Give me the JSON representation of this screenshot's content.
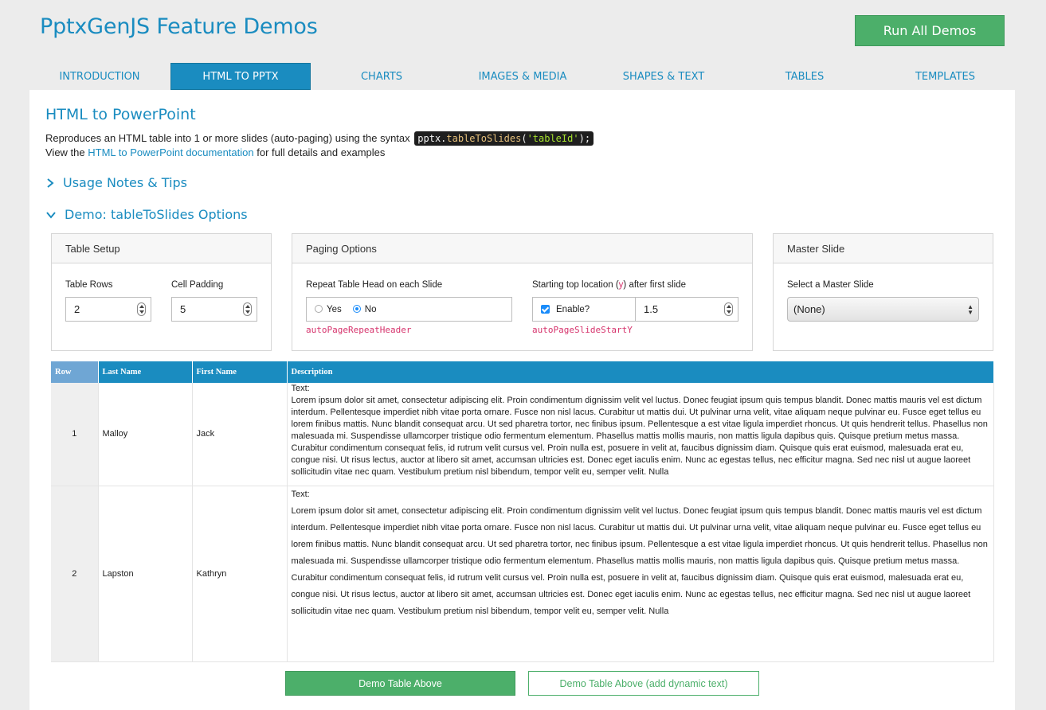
{
  "header": {
    "title": "PptxGenJS Feature Demos",
    "run_all_label": "Run All Demos"
  },
  "tabs": [
    {
      "label": "INTRODUCTION"
    },
    {
      "label": "HTML TO PPTX",
      "active": true
    },
    {
      "label": "CHARTS"
    },
    {
      "label": "IMAGES & MEDIA"
    },
    {
      "label": "SHAPES & TEXT"
    },
    {
      "label": "TABLES"
    },
    {
      "label": "TEMPLATES"
    }
  ],
  "section": {
    "title": "HTML to PowerPoint",
    "intro_text": "Reproduces an HTML table into 1 or more slides (auto-paging) using the syntax",
    "code": {
      "obj": "pptx.",
      "method": "tableToSlides",
      "open": "(",
      "arg": "'tableId'",
      "close": ");"
    },
    "docs_prefix": "View the",
    "docs_link": "HTML to PowerPoint documentation",
    "docs_suffix": "for full details and examples",
    "accordion_notes": "Usage Notes & Tips",
    "accordion_demo": "Demo: tableToSlides Options"
  },
  "table_setup": {
    "title": "Table Setup",
    "rows_label": "Table Rows",
    "rows_value": "2",
    "padding_label": "Cell Padding",
    "padding_value": "5"
  },
  "paging": {
    "title": "Paging Options",
    "repeat_label": "Repeat Table Head on each Slide",
    "yes_label": "Yes",
    "no_label": "No",
    "repeat_selected": "No",
    "repeat_prop": "autoPageRepeatHeader",
    "start_label_pre": "Starting top location (",
    "start_label_y": "y",
    "start_label_post": ") after first slide",
    "enable_label": "Enable?",
    "enable_checked": true,
    "start_value": "1.5",
    "start_prop": "autoPageSlideStartY"
  },
  "master": {
    "title": "Master Slide",
    "select_label": "Select a Master Slide",
    "selected": "(None)"
  },
  "demo_table": {
    "headers": [
      "Row",
      "Last Name",
      "First Name",
      "Description"
    ],
    "rows": [
      {
        "num": "1",
        "last": "Malloy",
        "first": "Jack",
        "desc_title": "Text:",
        "desc": "Lorem ipsum dolor sit amet, consectetur adipiscing elit. Proin condimentum dignissim velit vel luctus. Donec feugiat ipsum quis tempus blandit. Donec mattis mauris vel est dictum interdum. Pellentesque imperdiet nibh vitae porta ornare. Fusce non nisl lacus. Curabitur ut mattis dui. Ut pulvinar urna velit, vitae aliquam neque pulvinar eu. Fusce eget tellus eu lorem finibus mattis. Nunc blandit consequat arcu. Ut sed pharetra tortor, nec finibus ipsum. Pellentesque a est vitae ligula imperdiet rhoncus. Ut quis hendrerit tellus. Phasellus non malesuada mi. Suspendisse ullamcorper tristique odio fermentum elementum. Phasellus mattis mollis mauris, non mattis ligula dapibus quis. Quisque pretium metus massa. Curabitur condimentum consequat felis, id rutrum velit cursus vel. Proin nulla est, posuere in velit at, faucibus dignissim diam. Quisque quis erat euismod, malesuada erat eu, congue nisi. Ut risus lectus, auctor at libero sit amet, accumsan ultricies est. Donec eget iaculis enim. Nunc ac egestas tellus, nec efficitur magna. Sed nec nisl ut augue laoreet sollicitudin vitae nec quam. Vestibulum pretium nisl bibendum, tempor velit eu, semper velit. Nulla"
      },
      {
        "num": "2",
        "last": "Lapston",
        "first": "Kathryn",
        "desc_title": "Text:",
        "desc": "Lorem ipsum dolor sit amet, consectetur adipiscing elit. Proin condimentum dignissim velit vel luctus. Donec feugiat ipsum quis tempus blandit. Donec mattis mauris vel est dictum interdum. Pellentesque imperdiet nibh vitae porta ornare. Fusce non nisl lacus. Curabitur ut mattis dui. Ut pulvinar urna velit, vitae aliquam neque pulvinar eu. Fusce eget tellus eu lorem finibus mattis. Nunc blandit consequat arcu. Ut sed pharetra tortor, nec finibus ipsum. Pellentesque a est vitae ligula imperdiet rhoncus. Ut quis hendrerit tellus. Phasellus non malesuada mi. Suspendisse ullamcorper tristique odio fermentum elementum. Phasellus mattis mollis mauris, non mattis ligula dapibus quis. Quisque pretium metus massa. Curabitur condimentum consequat felis, id rutrum velit cursus vel. Proin nulla est, posuere in velit at, faucibus dignissim diam. Quisque quis erat euismod, malesuada erat eu, congue nisi. Ut risus lectus, auctor at libero sit amet, accumsan ultricies est. Donec eget iaculis enim. Nunc ac egestas tellus, nec efficitur magna. Sed nec nisl ut augue laoreet sollicitudin vitae nec quam. Vestibulum pretium nisl bibendum, tempor velit eu, semper velit. Nulla"
      }
    ]
  },
  "buttons": {
    "demo_label": "Demo Table Above",
    "demo_dynamic_label": "Demo Table Above (add dynamic text)"
  },
  "colors": {
    "accent": "#1a8cc0",
    "green": "#4caf6a",
    "prop_red": "#d6336c"
  }
}
